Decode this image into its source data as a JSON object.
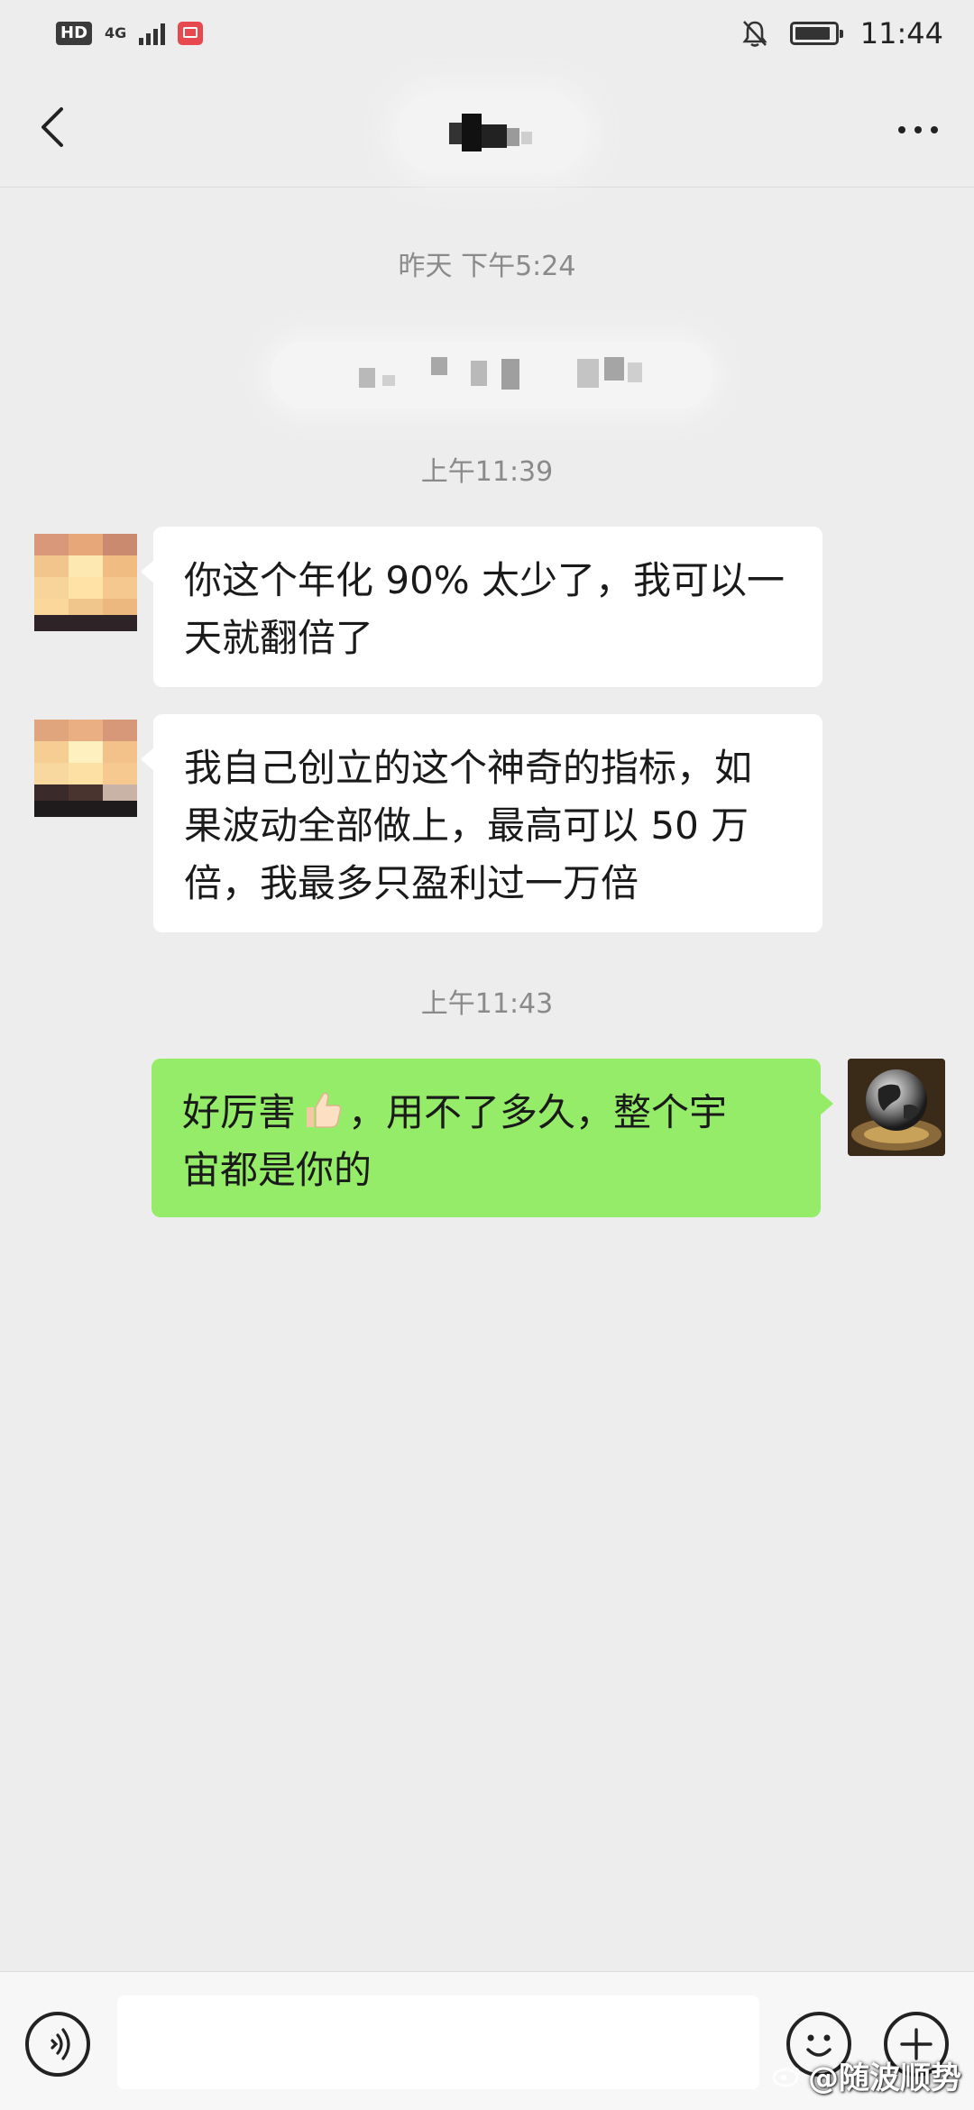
{
  "status_bar": {
    "hd": "HD",
    "network": "4G",
    "clock": "11:44",
    "icons": [
      "hd-icon",
      "signal-icon",
      "book-app-icon",
      "mute-notification-icon",
      "battery-icon"
    ]
  },
  "header": {
    "title": "",
    "back_icon": "chevron-left-icon",
    "more_icon": "more-dots-icon"
  },
  "chat": {
    "timestamps": [
      "昨天 下午5:24",
      "上午11:39",
      "上午11:43"
    ],
    "messages": [
      {
        "sender": "contact",
        "text_lines": [
          "你这个年化 90% 太少了，我可以一",
          "天就翻倍了"
        ]
      },
      {
        "sender": "contact",
        "text_lines": [
          "我自己创立的这个神奇的指标，如",
          "果波动全部做上，最高可以 50 万",
          "倍，我最多只盈利过一万倍"
        ]
      },
      {
        "sender": "me",
        "text_before_emoji": "好厉害",
        "emoji": "thumbs-up-icon",
        "text_after_emoji": "，用不了多久，整个宇",
        "text_line_2": "宙都是你的"
      }
    ]
  },
  "input_bar": {
    "placeholder": "",
    "icons": [
      "voice-icon",
      "emoji-icon",
      "plus-icon"
    ]
  },
  "watermark": {
    "text": "@随波顺势"
  },
  "colors": {
    "background": "#ededed",
    "bubble_in": "#ffffff",
    "bubble_out": "#95ec69",
    "timestamp": "#8a8a8a"
  }
}
